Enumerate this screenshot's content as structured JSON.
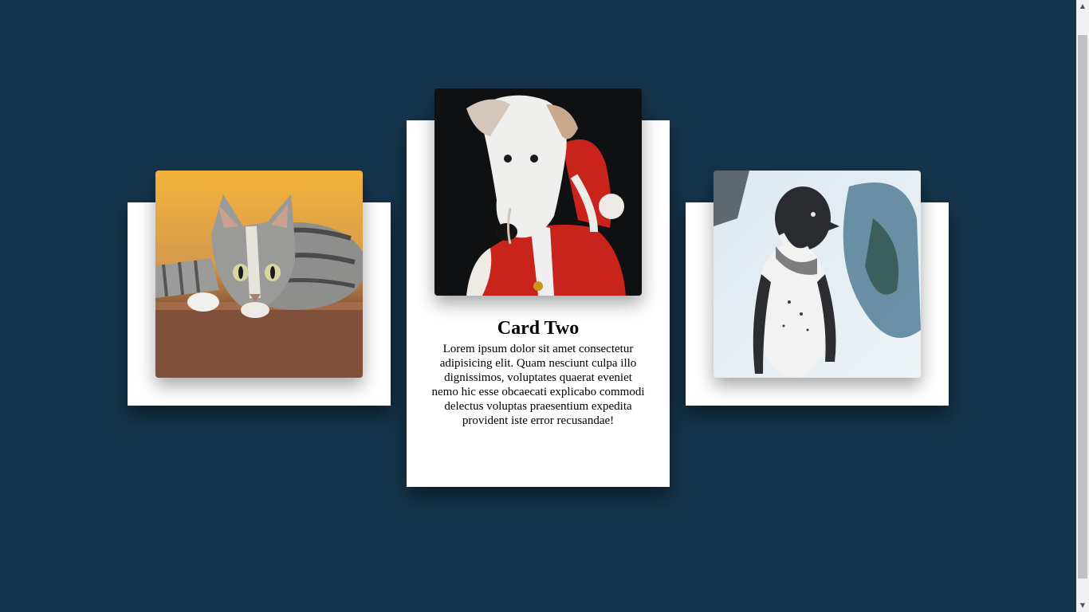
{
  "cards": [
    {
      "image": "cat-photo",
      "title": "",
      "text": ""
    },
    {
      "image": "dog-in-santa-outfit-photo",
      "title": "Card Two",
      "text": "Lorem ipsum dolor sit amet consectetur adipisicing elit. Quam nesciunt culpa illo dignissimos, voluptates quaerat eveniet nemo hic esse obcaecati explicabo commodi delectus voluptas praesentium expedita provident iste error recusandae!"
    },
    {
      "image": "penguin-photo",
      "title": "",
      "text": ""
    }
  ],
  "colors": {
    "background": "#15344b",
    "card": "#ffffff"
  },
  "scrollbar": {
    "up_arrow": "▲",
    "down_arrow": "▼"
  }
}
